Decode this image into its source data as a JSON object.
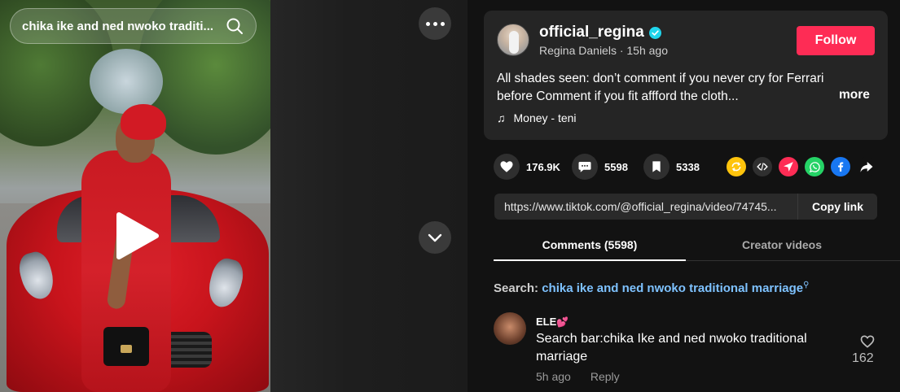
{
  "video": {
    "search_value": "chika ike and ned nwoko traditi...",
    "search_placeholder": "Search"
  },
  "author": {
    "username": "official_regina",
    "display_name": "Regina Daniels",
    "time_ago": "15h ago",
    "subline": "Regina Daniels · 15h ago",
    "verified": true,
    "follow_label": "Follow"
  },
  "post": {
    "caption": "All shades seen: don’t comment if you never cry for Ferrari before Comment if you fit affford the cloth...",
    "more_label": "more",
    "music": "Money - teni"
  },
  "actions": {
    "likes": "176.9K",
    "comments": "5598",
    "saves": "5338"
  },
  "share_icons": [
    {
      "name": "repost-icon",
      "color": "#ffc40c"
    },
    {
      "name": "embed-icon",
      "color": "#2f2f2f"
    },
    {
      "name": "send-icon",
      "color": "#fe2c55"
    },
    {
      "name": "whatsapp-icon",
      "color": "#25d366"
    },
    {
      "name": "facebook-icon",
      "color": "#1877f2"
    },
    {
      "name": "share-arrow-icon",
      "color": "#121212"
    }
  ],
  "link": {
    "url": "https://www.tiktok.com/@official_regina/video/74745...",
    "copy_label": "Copy link"
  },
  "tabs": [
    {
      "label": "Comments (5598)",
      "active": true
    },
    {
      "label": "Creator videos",
      "active": false
    }
  ],
  "search_hint": {
    "prefix": "Search: ",
    "query": "chika ike and ned nwoko traditional marriage"
  },
  "comments": [
    {
      "user": "ELE",
      "emoji": "💕",
      "text": "Search bar:chika Ike and ned nwoko traditional marriage",
      "time": "5h ago",
      "reply_label": "Reply",
      "likes": "162"
    }
  ],
  "colors": {
    "accent": "#fe2c55",
    "link_blue": "#7ec2ff",
    "panel_bg": "#121212",
    "card_bg": "#252525"
  }
}
